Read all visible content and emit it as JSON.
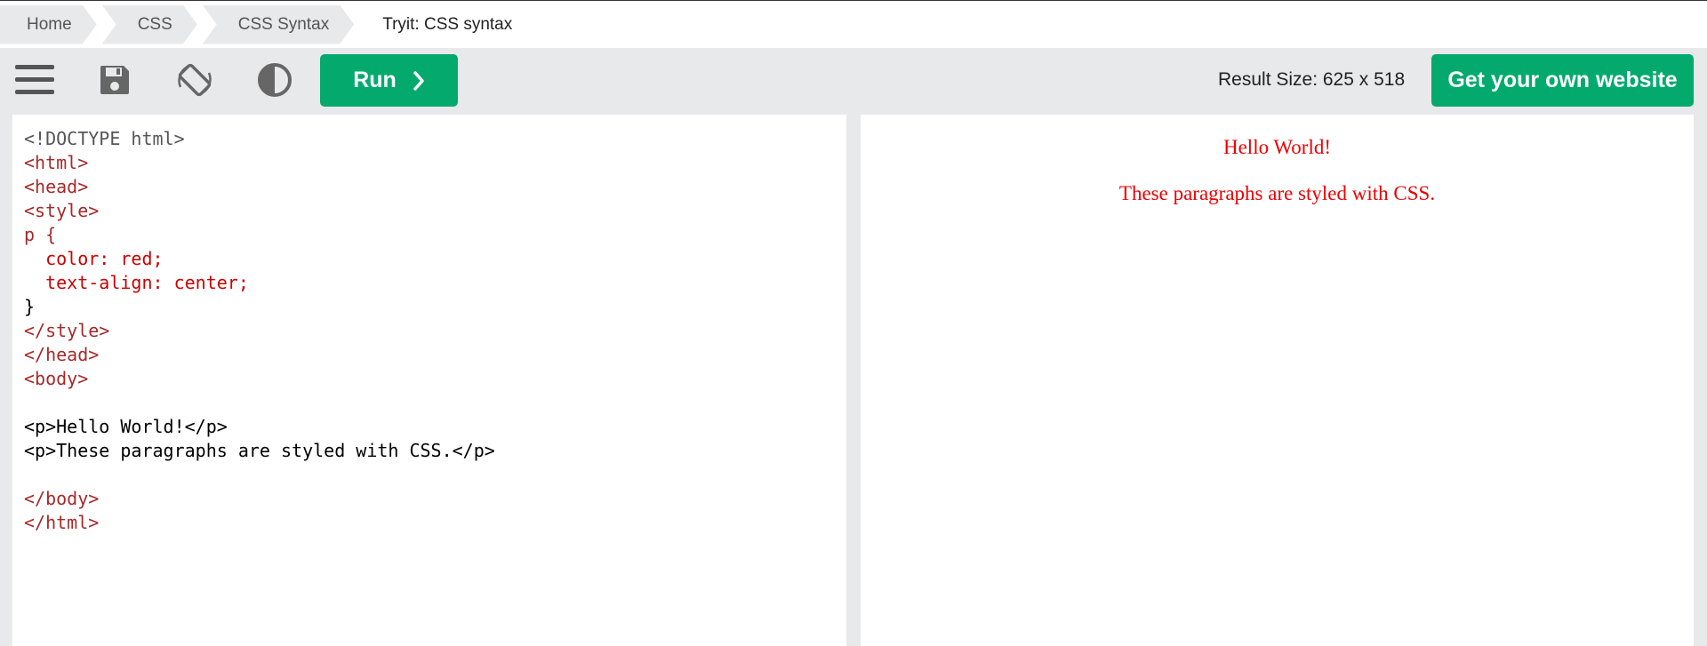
{
  "breadcrumb": {
    "items": [
      "Home",
      "CSS",
      "CSS Syntax"
    ],
    "current": "Tryit: CSS syntax"
  },
  "toolbar": {
    "icons": [
      "menu-icon",
      "save-icon",
      "rotate-icon",
      "contrast-icon"
    ],
    "run_label": "Run",
    "result_size": "Result Size: 625 x 518",
    "own_site_label": "Get your own website"
  },
  "colors": {
    "accent": "#04aa6d",
    "background": "#e7e9eb",
    "result_text": "#ff0000"
  },
  "code": {
    "lines": [
      "<!DOCTYPE html>",
      "<html>",
      "<head>",
      "<style>",
      "p {",
      "  color: red;",
      "  text-align: center;",
      "}",
      "</style>",
      "</head>",
      "<body>",
      "",
      "<p>Hello World!</p>",
      "<p>These paragraphs are styled with CSS.</p>",
      "",
      "</body>",
      "</html>"
    ]
  },
  "result": {
    "paragraph1": "Hello World!",
    "paragraph2": "These paragraphs are styled with CSS."
  }
}
